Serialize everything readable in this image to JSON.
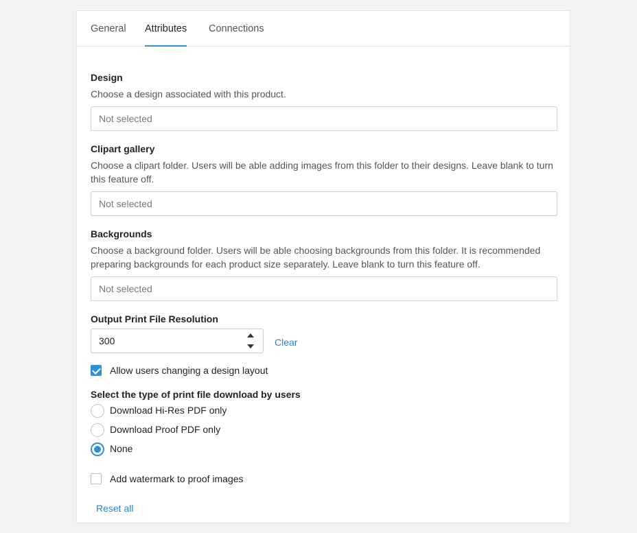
{
  "tabs": [
    {
      "label": "General"
    },
    {
      "label": "Attributes"
    },
    {
      "label": "Connections"
    }
  ],
  "design": {
    "label": "Design",
    "description": "Choose a design associated with this product.",
    "value": "Not selected"
  },
  "clipart": {
    "label": "Clipart gallery",
    "description_line1": "Choose a clipart folder. Users will be able adding images from this folder to their designs. Leave blank to turn",
    "description_line2": "this feature off.",
    "value": "Not selected"
  },
  "backgrounds": {
    "label": "Backgrounds",
    "description_line1": "Choose a background folder. Users will be able choosing backgrounds from this folder. It is recommended",
    "description_line2": "preparing backgrounds for each product size separately. Leave blank to turn this feature off.",
    "value": "Not selected"
  },
  "resolution": {
    "label": "Output Print File Resolution",
    "value": "300",
    "clear_label": "Clear"
  },
  "allow_layout": {
    "label": "Allow users changing a design layout",
    "checked": true
  },
  "download_type": {
    "label": "Select the type of print file download by users",
    "options": [
      {
        "label": "Download Hi-Res PDF only",
        "selected": false
      },
      {
        "label": "Download Proof PDF only",
        "selected": false
      },
      {
        "label": "None",
        "selected": true
      }
    ]
  },
  "watermark": {
    "label": "Add watermark to proof images",
    "checked": false
  },
  "reset_label": "Reset all",
  "colors": {
    "accent": "#2f8fd8",
    "link": "#1f8ad8"
  }
}
